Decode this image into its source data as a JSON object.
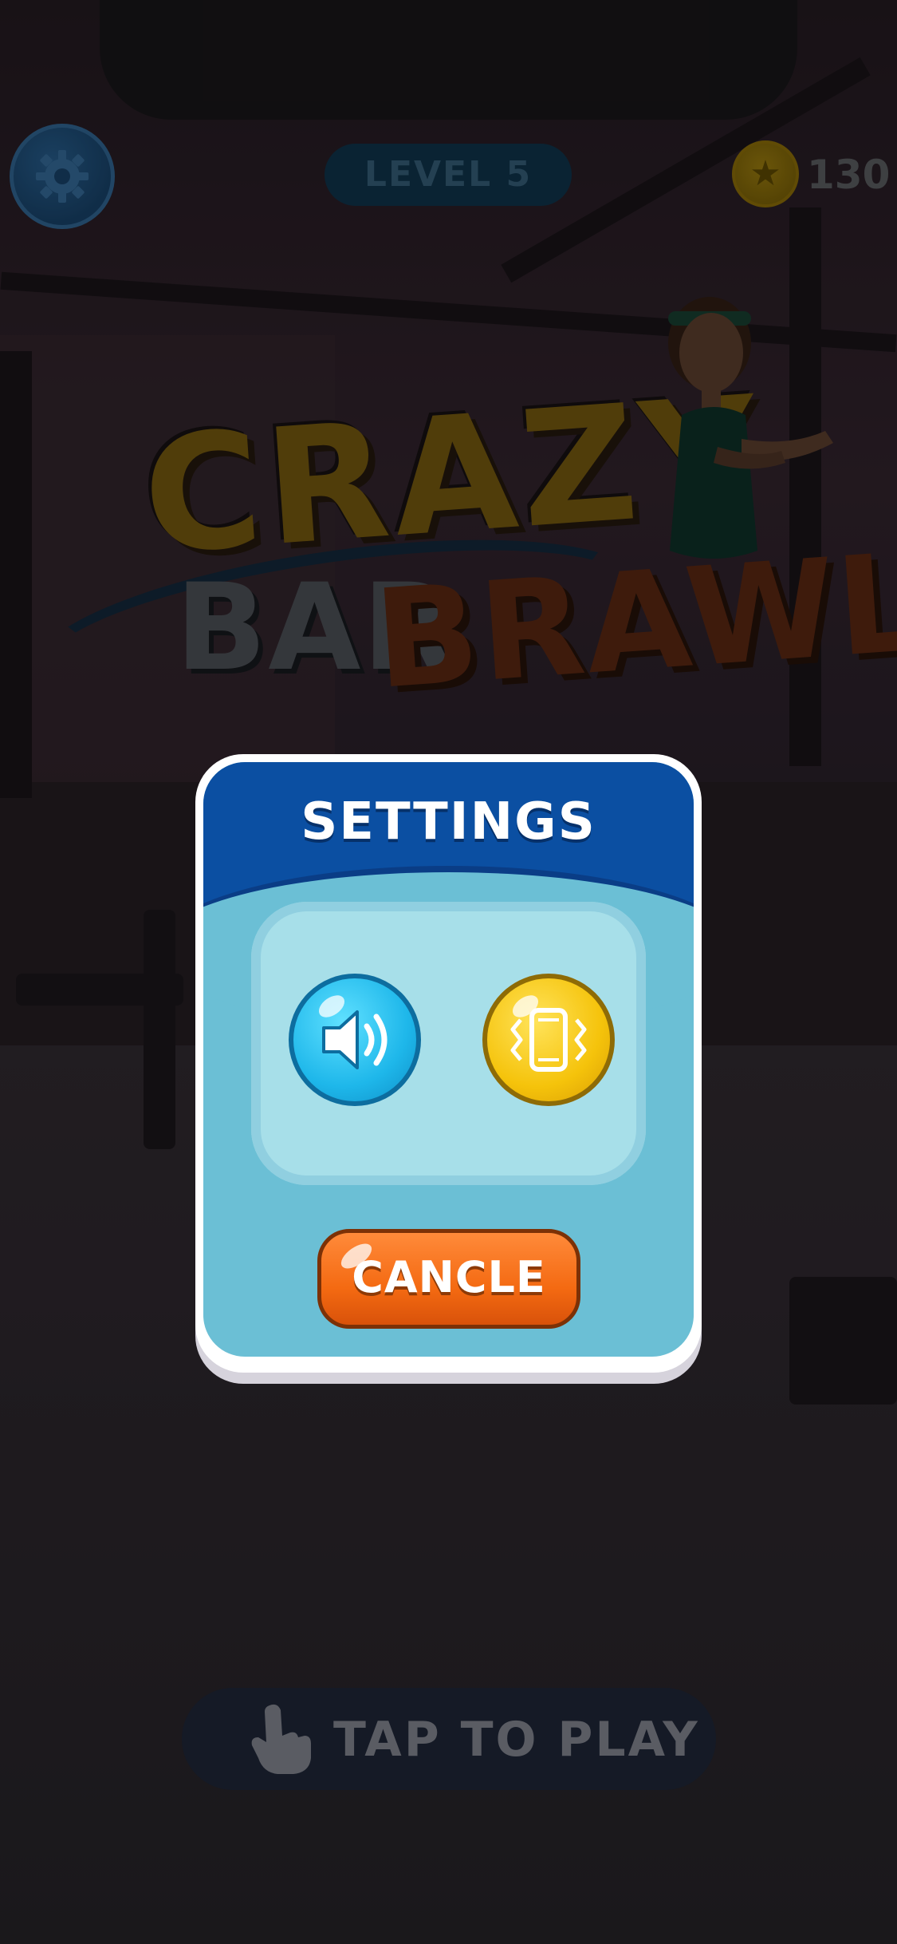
{
  "hud": {
    "level_label": "LEVEL 5",
    "coin_count": "130",
    "settings_icon": "gear-icon",
    "coin_icon": "star-coin-icon"
  },
  "logo": {
    "line1": "CRAZY",
    "line2_a": "BAR",
    "line2_b": "BRAWL"
  },
  "settings_dialog": {
    "title": "SETTINGS",
    "sound_icon": "speaker-icon",
    "vibration_icon": "vibration-icon",
    "cancel_label": "CANCLE"
  },
  "tap_to_play": {
    "label": "TAP TO PLAY",
    "icon": "pointing-hand-icon"
  },
  "colors": {
    "dialog_header": "#0b4fa2",
    "dialog_body": "#6bbfd5",
    "panel": "#a7dfe9",
    "sound_button": "#1eb7ea",
    "vibration_button": "#f5c30b",
    "cancel_button": "#f46a12"
  }
}
